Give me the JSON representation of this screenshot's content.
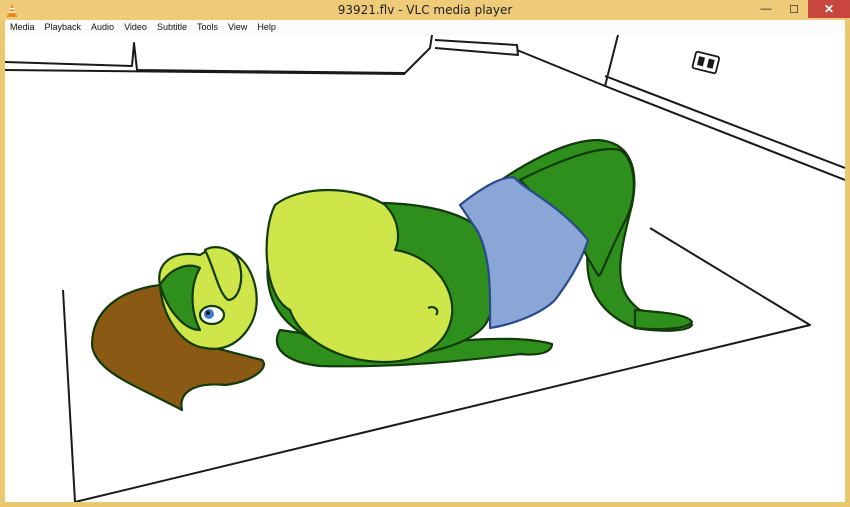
{
  "window": {
    "title": "93921.flv - VLC media player",
    "app_icon": "vlc-cone-icon",
    "controls": {
      "minimize_icon": "minimize-icon",
      "maximize_icon": "maximize-icon",
      "close_icon": "close-icon",
      "minimize_glyph": "—",
      "maximize_glyph": "☐",
      "close_glyph": "✕"
    }
  },
  "menubar": {
    "items": [
      "Media",
      "Playback",
      "Audio",
      "Video",
      "Subtitle",
      "Tools",
      "View",
      "Help"
    ]
  },
  "video": {
    "content": "cartoon-frame"
  },
  "colors": {
    "titlebar": "#edcb78",
    "close_button": "#c7463d",
    "skin_light": "#cfe64a",
    "skin_dark": "#2a8a1a",
    "shorts": "#8aa6d6",
    "hair": "#8a5a14"
  }
}
